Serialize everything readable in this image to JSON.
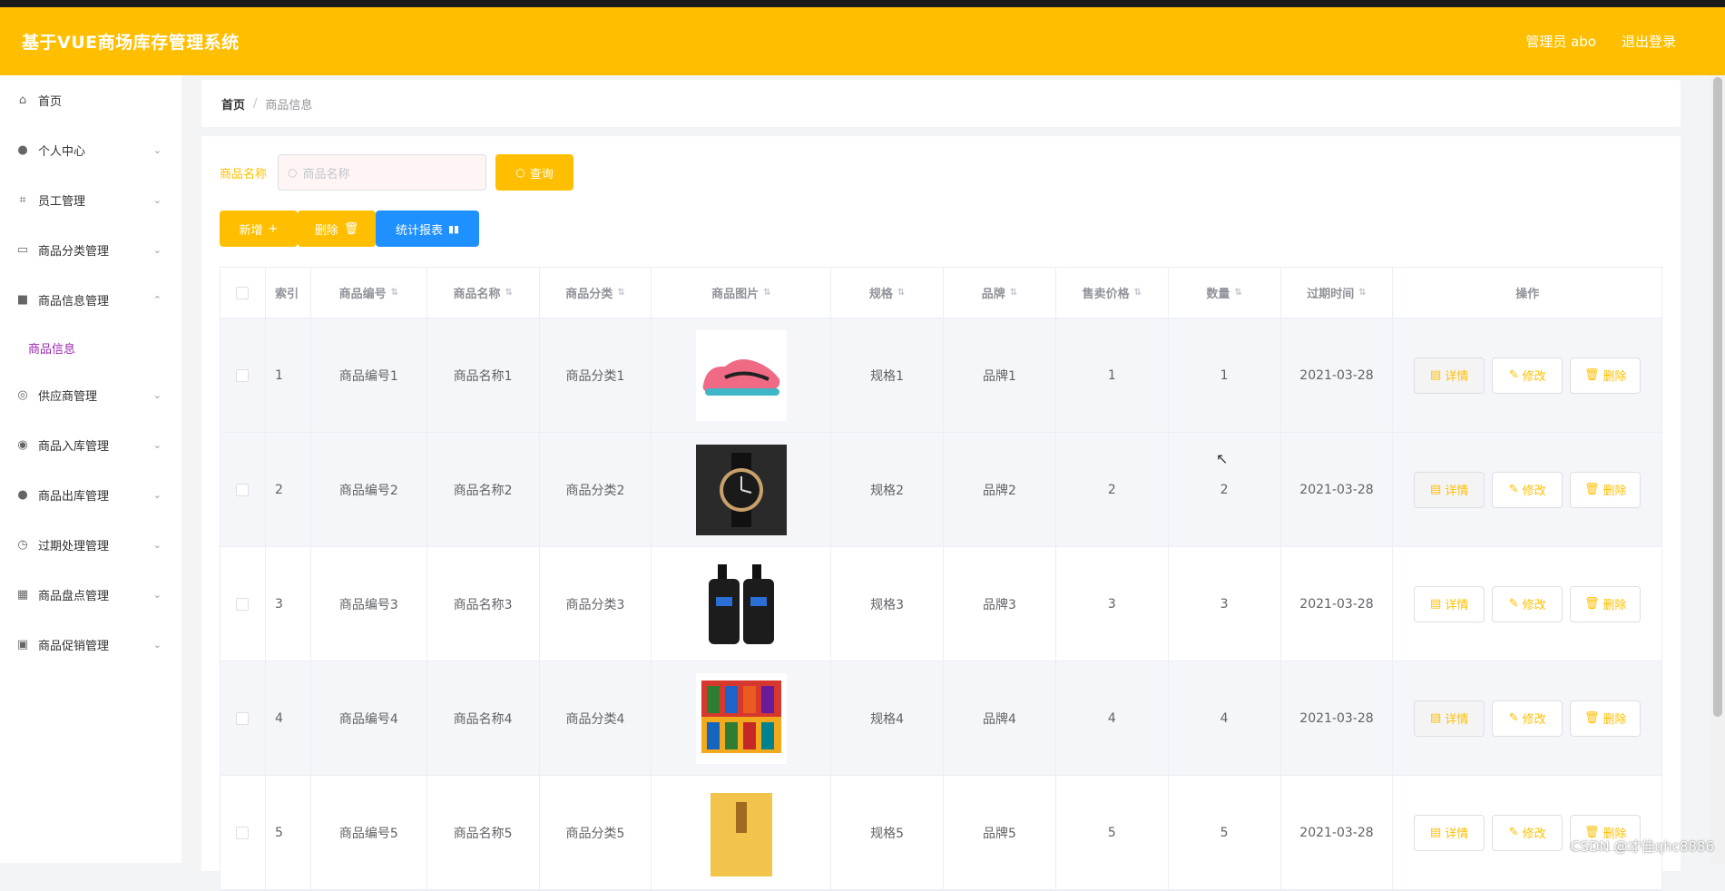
{
  "header": {
    "title": "基于VUE商场库存管理系统",
    "user": "管理员 abo",
    "logout": "退出登录"
  },
  "sidebar": {
    "items": [
      {
        "label": "首页",
        "icon": "home-icon",
        "chevron": false
      },
      {
        "label": "个人中心",
        "icon": "user-icon",
        "chevron": true
      },
      {
        "label": "员工管理",
        "icon": "crop-icon",
        "chevron": true
      },
      {
        "label": "商品分类管理",
        "icon": "id-card-icon",
        "chevron": true
      },
      {
        "label": "商品信息管理",
        "icon": "briefcase-icon",
        "chevron": true,
        "expanded": true
      },
      {
        "label": "供应商管理",
        "icon": "compass-icon",
        "chevron": true
      },
      {
        "label": "商品入库管理",
        "icon": "lifebuoy-icon",
        "chevron": true
      },
      {
        "label": "商品出库管理",
        "icon": "user-icon",
        "chevron": true
      },
      {
        "label": "过期处理管理",
        "icon": "clock-icon",
        "chevron": true
      },
      {
        "label": "商品盘点管理",
        "icon": "grid-icon",
        "chevron": true
      },
      {
        "label": "商品促销管理",
        "icon": "clipboard-icon",
        "chevron": true
      }
    ],
    "subitem": "商品信息"
  },
  "breadcrumb": {
    "home": "首页",
    "separator": "/",
    "current": "商品信息"
  },
  "search": {
    "label": "商品名称",
    "placeholder": "商品名称",
    "button": "查询"
  },
  "actions": {
    "add": "新增",
    "delete": "删除",
    "stats": "统计报表"
  },
  "table": {
    "columns": [
      "索引",
      "商品编号",
      "商品名称",
      "商品分类",
      "商品图片",
      "规格",
      "品牌",
      "售卖价格",
      "数量",
      "过期时间",
      "操作"
    ],
    "rows": [
      {
        "index": "1",
        "code": "商品编号1",
        "name": "商品名称1",
        "category": "商品分类1",
        "image": "pink-sneaker",
        "spec": "规格1",
        "brand": "品牌1",
        "price": "1",
        "qty": "1",
        "expire": "2021-03-28"
      },
      {
        "index": "2",
        "code": "商品编号2",
        "name": "商品名称2",
        "category": "商品分类2",
        "image": "wristwatch",
        "spec": "规格2",
        "brand": "品牌2",
        "price": "2",
        "qty": "2",
        "expire": "2021-03-28"
      },
      {
        "index": "3",
        "code": "商品编号3",
        "name": "商品名称3",
        "category": "商品分类3",
        "image": "mens-facewash-bottles",
        "spec": "规格3",
        "brand": "品牌3",
        "price": "3",
        "qty": "3",
        "expire": "2021-03-28"
      },
      {
        "index": "4",
        "code": "商品编号4",
        "name": "商品名称4",
        "category": "商品分类4",
        "image": "snack-packages",
        "spec": "规格4",
        "brand": "品牌4",
        "price": "4",
        "qty": "4",
        "expire": "2021-03-28"
      },
      {
        "index": "5",
        "code": "商品编号5",
        "name": "商品名称5",
        "category": "商品分类5",
        "image": "yellow-book",
        "spec": "规格5",
        "brand": "品牌5",
        "price": "5",
        "qty": "5",
        "expire": "2021-03-28"
      }
    ],
    "ops": {
      "detail": "详情",
      "edit": "修改",
      "delete": "删除"
    }
  },
  "watermark": "CSDN @才佳qhc8886",
  "colors": {
    "accent": "#ffbf00",
    "blue": "#1e90ff",
    "submenu": "#9c27b0"
  }
}
